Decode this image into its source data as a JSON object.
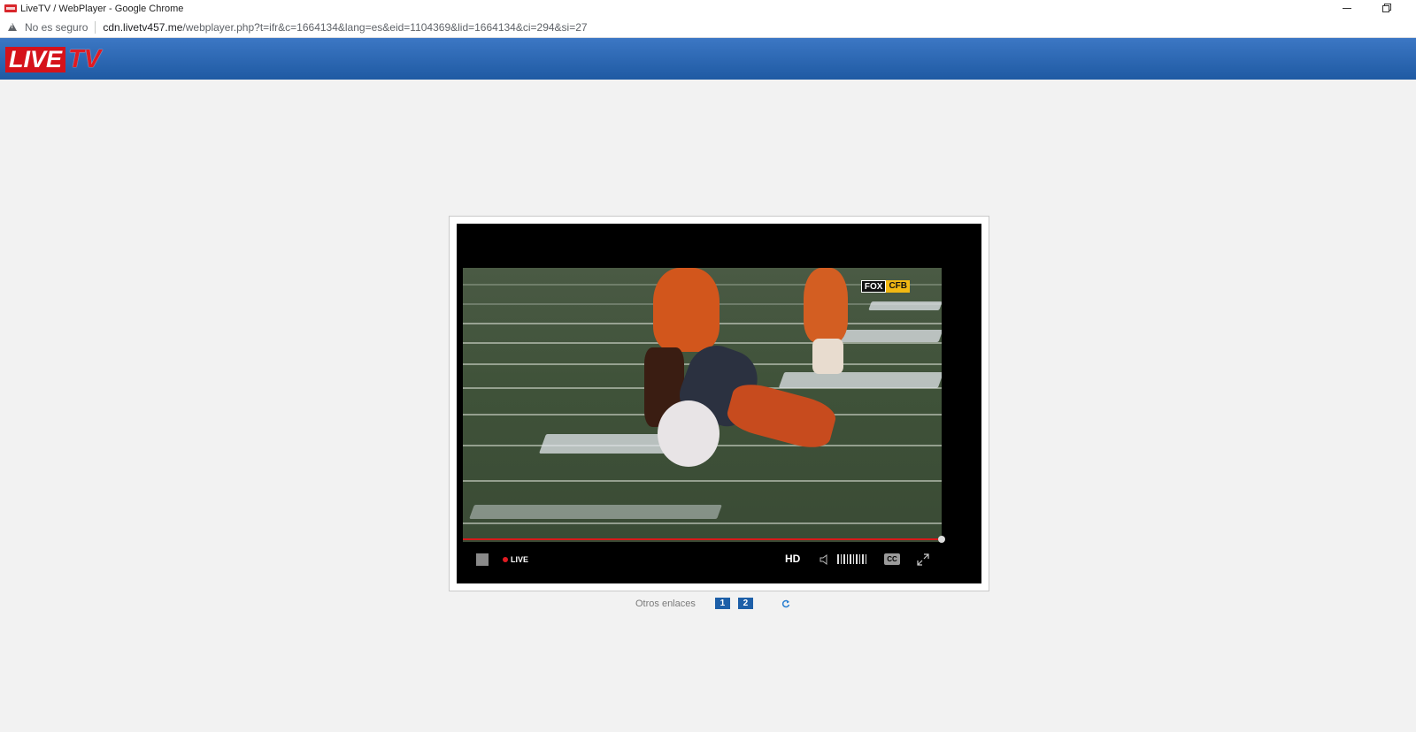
{
  "window": {
    "title": "LiveTV / WebPlayer - Google Chrome"
  },
  "addressbar": {
    "security_label": "No es seguro",
    "url_host": "cdn.livetv457.me",
    "url_path": "/webplayer.php?t=ifr&c=1664134&lang=es&eid=1104369&lid=1664134&ci=294&si=27"
  },
  "site": {
    "logo_live": "LIVE",
    "logo_tv": "TV"
  },
  "video": {
    "network_logo_part1": "FOX",
    "network_logo_part2": "CFB",
    "progress": 1.0
  },
  "controls": {
    "live_label": "LIVE",
    "hd_label": "HD",
    "cc_label": "CC"
  },
  "links": {
    "label": "Otros enlaces",
    "items": [
      "1",
      "2"
    ]
  },
  "colors": {
    "header_top": "#3c77c4",
    "header_bottom": "#1f5aa3",
    "logo_red": "#d5121a",
    "link_blue": "#1d5fa8",
    "progress_red": "#d71a1a"
  }
}
